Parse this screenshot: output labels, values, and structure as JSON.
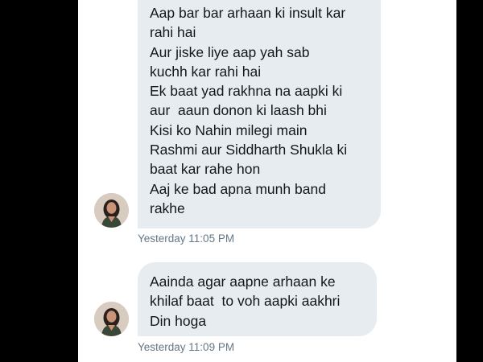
{
  "conversation": {
    "messages": [
      {
        "lines": [
          "Aap bar bar arhaan ki insult kar",
          "rahi hai",
          "Aur jiske liye aap yah sab",
          "kuchh kar rahi hai",
          "Ek baat yad rakhna na aapki ki",
          "aur  aaun donon ki laash bhi",
          "Kisi ko Nahin milegi main",
          "Rashmi aur Siddharth Shukla ki",
          "baat kar rahe hon",
          "Aaj ke bad apna munh band",
          "rakhe"
        ],
        "timestamp": "Yesterday 11:05 PM",
        "avatar_icon": "user-avatar-icon"
      },
      {
        "lines": [
          "Aainda agar aapne arhaan ke",
          "khilaf baat  to voh aapki aakhri",
          "Din hoga"
        ],
        "timestamp": "Yesterday 11:09 PM",
        "avatar_icon": "user-avatar-icon"
      }
    ]
  },
  "colors": {
    "bubble_background": "#e6ecf0",
    "message_text": "#14171a",
    "timestamp_text": "#657786",
    "page_background": "#ffffff",
    "letterbox": "#000000"
  }
}
